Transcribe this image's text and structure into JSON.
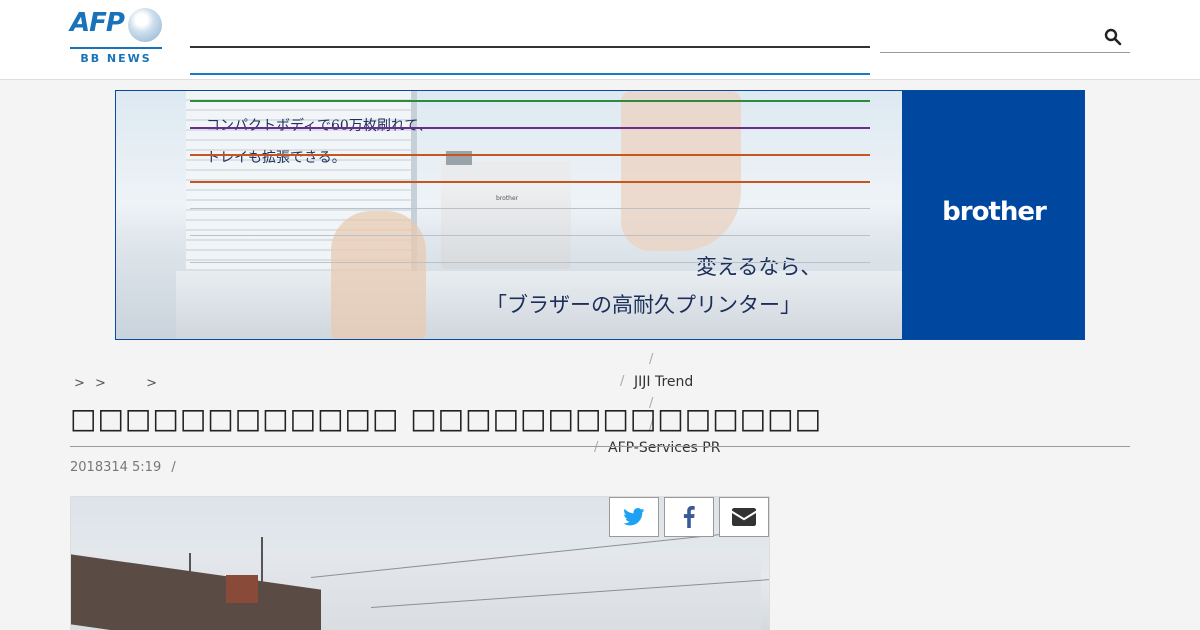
{
  "header": {
    "logo_text": "AFP",
    "logo_subtext": "BB NEWS",
    "search": {
      "placeholder": "",
      "value": ""
    },
    "colors": {
      "brand": "#1a73b8",
      "nav_active": "#1a7ac4"
    }
  },
  "ad": {
    "copy_line_1": "コンパクトボディで60万枚刷れて、",
    "copy_line_2": "トレイも拡張できる。",
    "headline_1": "変えるなら、",
    "headline_2": "「ブラザーの高耐久プリンター」",
    "printer_brand": "brother",
    "brand": "brother",
    "brand_color": "#0047a0"
  },
  "nav_overlay": {
    "line_colors": [
      "#2e8b3e",
      "#6a2c91",
      "#c8551b",
      "#c8551b"
    ],
    "separators": [
      "/",
      "/",
      "/",
      "/",
      "/"
    ],
    "items": [
      "JIJI Trend",
      "AFP-Services PR"
    ]
  },
  "breadcrumb": {
    "separators": [
      ">",
      ">",
      ">"
    ]
  },
  "article": {
    "title": "□□□□□□□□□□□□ □□□□□□□□□□□□□□□",
    "date": "2018314 5:19",
    "date_separator": "/"
  },
  "share": {
    "buttons": [
      {
        "icon": "twitter-icon",
        "color": "#1da1f2"
      },
      {
        "icon": "facebook-icon",
        "color": "#3b5998"
      },
      {
        "icon": "mail-icon",
        "color": "#333333"
      }
    ]
  }
}
